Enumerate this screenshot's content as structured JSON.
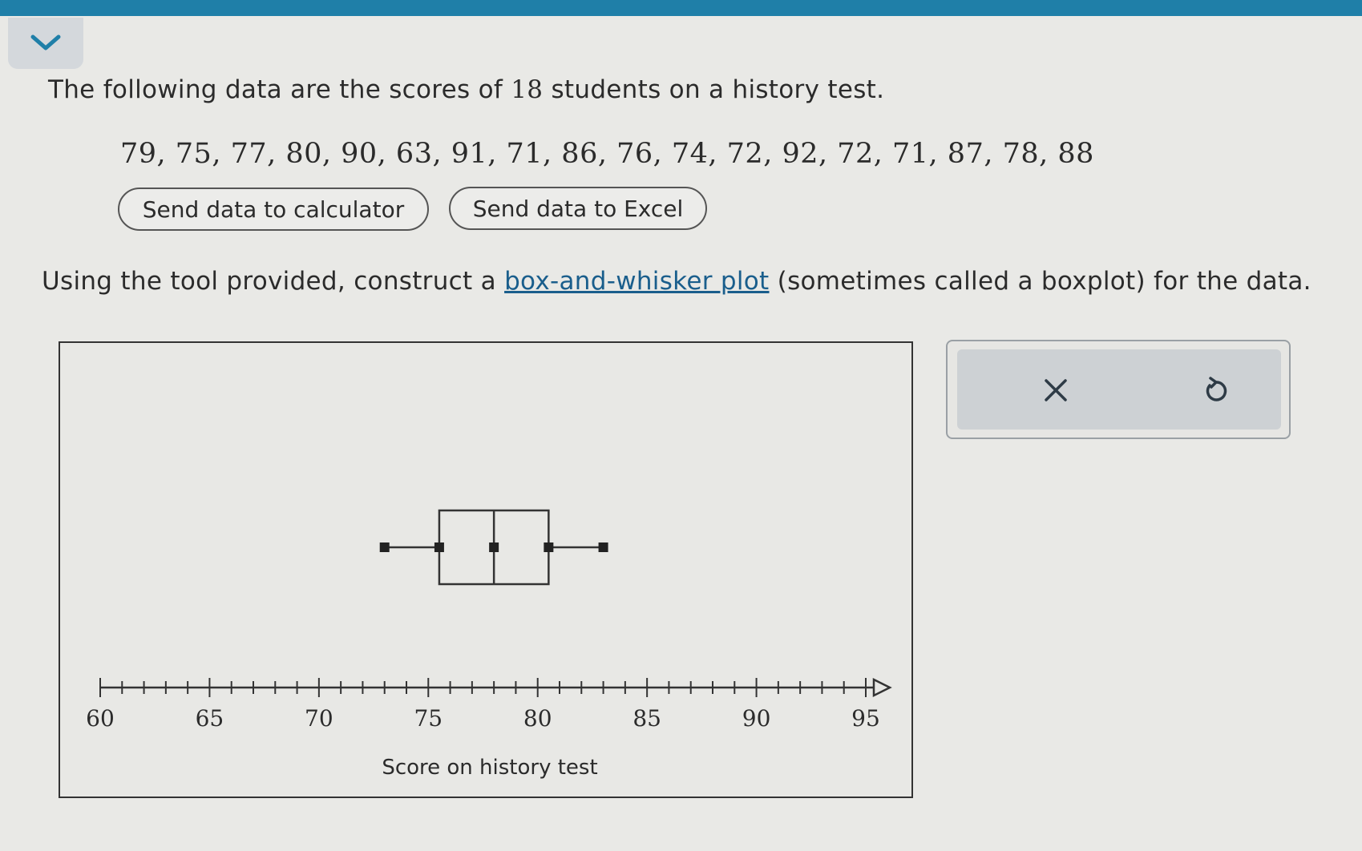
{
  "header": {
    "collapse_icon": "chevron-down-icon"
  },
  "question": {
    "prompt_before": "The following data are the scores of ",
    "prompt_count": "18",
    "prompt_after": " students on a history test.",
    "data_values": "79, 75, 77, 80, 90, 63, 91, 71, 86, 76, 74, 72, 92, 72, 71, 87, 78, 88",
    "buttons": {
      "calculator": "Send data to calculator",
      "excel": "Send data to Excel"
    },
    "instruction_before": "Using the tool provided, construct a ",
    "instruction_link": "box-and-whisker plot",
    "instruction_after": " (sometimes called a boxplot) for the data."
  },
  "chart_data": {
    "type": "boxplot",
    "xlabel": "Score on history test",
    "xlim": [
      60,
      95
    ],
    "tick_labels": [
      "60",
      "65",
      "70",
      "75",
      "80",
      "85",
      "90",
      "95"
    ],
    "minor_tick_step": 1,
    "grid": false,
    "box": {
      "min": 73,
      "q1": 75.5,
      "median": 78,
      "q3": 80.5,
      "max": 83
    }
  },
  "tools": {
    "clear_icon": "close-icon",
    "undo_icon": "undo-icon"
  },
  "colors": {
    "topbar": "#1f7fa8",
    "link": "#1a5e8c",
    "background": "#e9e9e6"
  }
}
